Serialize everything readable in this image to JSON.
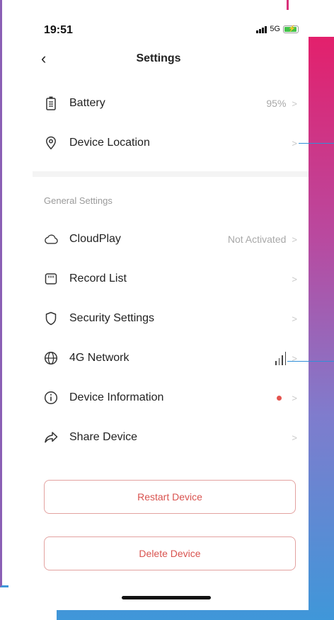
{
  "status_bar": {
    "time": "19:51",
    "network": "5G"
  },
  "header": {
    "back_icon": "chevron-left-icon",
    "title": "Settings"
  },
  "device_rows": [
    {
      "icon": "battery-icon",
      "label": "Battery",
      "value": "95%"
    },
    {
      "icon": "location-pin-icon",
      "label": "Device Location",
      "value": ""
    }
  ],
  "general_section": {
    "title": "General Settings",
    "rows": [
      {
        "icon": "cloud-icon",
        "label": "CloudPlay",
        "value": "Not Activated"
      },
      {
        "icon": "sd-card-icon",
        "label": "Record List",
        "value": ""
      },
      {
        "icon": "shield-icon",
        "label": "Security Settings",
        "value": ""
      },
      {
        "icon": "globe-icon",
        "label": "4G Network",
        "value": "",
        "signal_indicator": "signal-bars-icon"
      },
      {
        "icon": "info-icon",
        "label": "Device Information",
        "value": "",
        "badge": "red-dot"
      },
      {
        "icon": "share-icon",
        "label": "Share Device",
        "value": ""
      }
    ]
  },
  "chevron_glyph": ">",
  "actions": {
    "restart_label": "Restart Device",
    "delete_label": "Delete Device"
  },
  "colors": {
    "accent_red": "#d9534f",
    "button_border": "#e3a2a0",
    "badge_red": "#e4544f",
    "gradient_top": "#e3206c",
    "gradient_bottom": "#3f97d9"
  }
}
